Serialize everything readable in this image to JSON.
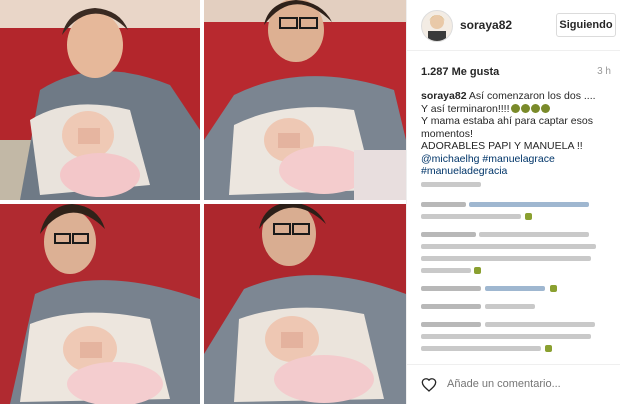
{
  "post": {
    "username": "soraya82",
    "follow_label": "Siguiendo",
    "likes": "1.287 Me gusta",
    "time": "3 h",
    "caption_user": "soraya82",
    "caption_lines": [
      "Así comenzaron los dos ....",
      "Y así terminaron!!!!",
      "Y mama estaba ahí para captar esos",
      "momentos!",
      "ADORABLES PAPI Y MANUELA !!"
    ],
    "mentions_line": "@michaelhg #manuelagrace",
    "hashtag_line": "#manueladegracia",
    "comment_placeholder": "Añade un comentario..."
  },
  "colors": {
    "link": "#003569",
    "muted": "#999999",
    "sofa_red": "#b3262c",
    "blanket_grey": "#9aa0a8"
  },
  "icons": [
    "heart-icon",
    "avatar",
    "emoji-icon"
  ]
}
